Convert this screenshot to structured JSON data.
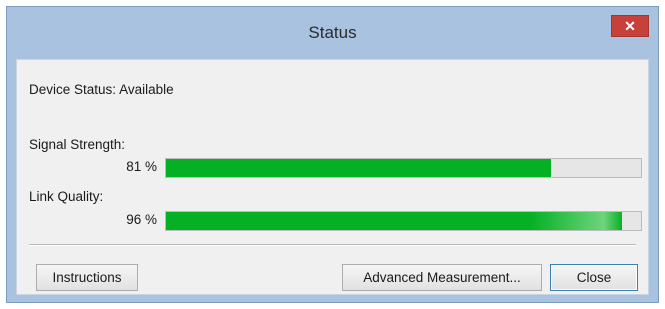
{
  "window": {
    "title": "Status",
    "close_glyph": "✕",
    "close_icon": "close-icon"
  },
  "device_status": {
    "label": "Device Status:",
    "value": "Available"
  },
  "signal_strength": {
    "label": "Signal Strength:",
    "percent_text": "81 %",
    "value": 0.81
  },
  "link_quality": {
    "label": "Link Quality:",
    "percent_text": "96 %",
    "value": 0.96
  },
  "buttons": {
    "instructions": "Instructions",
    "advanced_measurement": "Advanced Measurement...",
    "close": "Close"
  },
  "colors": {
    "progress_fill": "#06b025",
    "close_button": "#c7403a"
  }
}
